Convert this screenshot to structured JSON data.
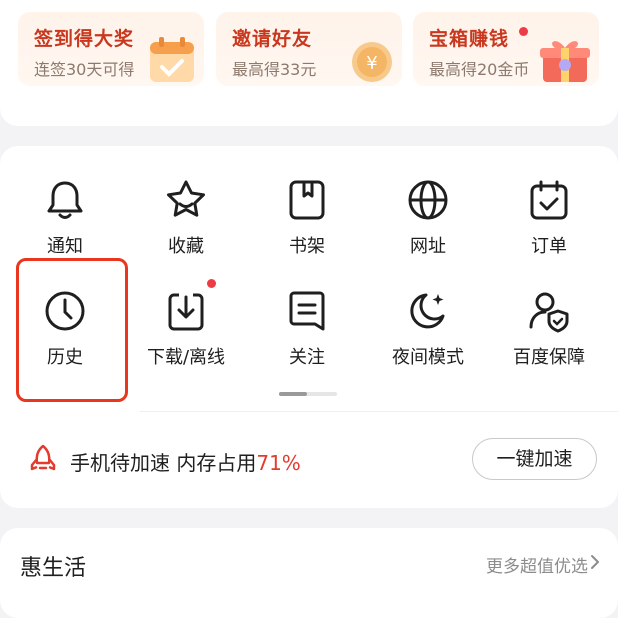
{
  "promos": [
    {
      "title": "签到得大奖",
      "subtitle": "连签30天可得",
      "icon": "calendar-check-icon",
      "badge": false
    },
    {
      "title": "邀请好友",
      "subtitle": "最高得33元",
      "icon": "yuan-coin-icon",
      "badge": false
    },
    {
      "title": "宝箱赚钱",
      "subtitle": "最高得20金币",
      "icon": "gift-box-icon",
      "badge": true
    }
  ],
  "tools": {
    "row1": [
      {
        "label": "通知",
        "icon": "bell-icon"
      },
      {
        "label": "收藏",
        "icon": "star-icon"
      },
      {
        "label": "书架",
        "icon": "bookshelf-icon"
      },
      {
        "label": "网址",
        "icon": "globe-icon"
      },
      {
        "label": "订单",
        "icon": "order-calendar-icon"
      }
    ],
    "row2": [
      {
        "label": "历史",
        "icon": "clock-icon",
        "highlighted": true
      },
      {
        "label": "下载/离线",
        "icon": "download-icon",
        "badge": true
      },
      {
        "label": "关注",
        "icon": "follow-note-icon"
      },
      {
        "label": "夜间模式",
        "icon": "moon-icon"
      },
      {
        "label": "百度保障",
        "icon": "user-shield-icon"
      }
    ]
  },
  "speed": {
    "text": "手机待加速 内存占用",
    "percent": "71%",
    "button": "一键加速"
  },
  "life": {
    "title": "惠生活",
    "more": "更多超值优选"
  },
  "colors": {
    "accent_red": "#e33b2e",
    "highlight_border": "#e8361f",
    "promo_title": "#c9381e",
    "badge_dot": "#ef3b45"
  }
}
